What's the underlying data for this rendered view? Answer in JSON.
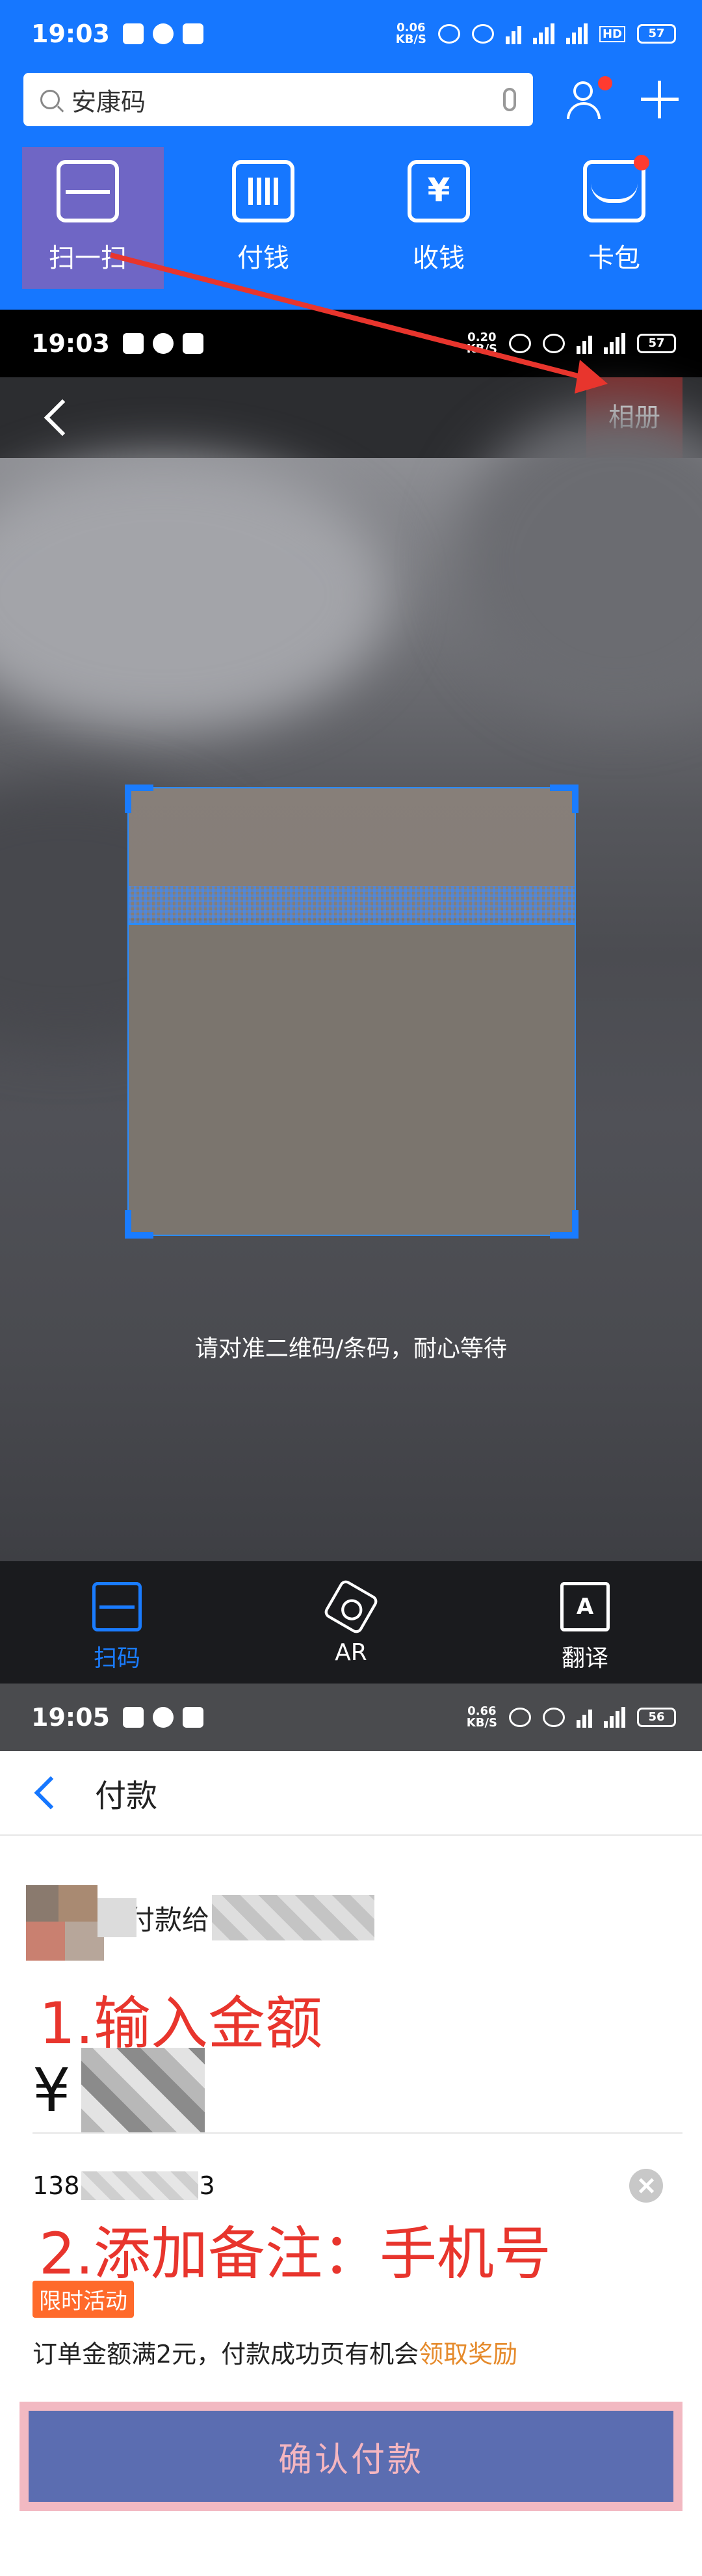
{
  "home": {
    "status": {
      "time": "19:03",
      "net_speed": "0.06",
      "net_unit": "KB/S",
      "signal1": "4G",
      "signal2": "4G",
      "hd": "HD",
      "battery": "57"
    },
    "search": {
      "placeholder": "安康码"
    },
    "quick_actions": [
      {
        "label": "扫一扫",
        "icon": "scan-icon"
      },
      {
        "label": "付钱",
        "icon": "barcode-icon"
      },
      {
        "label": "收钱",
        "icon": "yen-icon"
      },
      {
        "label": "卡包",
        "icon": "wallet-icon"
      }
    ]
  },
  "scanner": {
    "status": {
      "time": "19:03",
      "net_speed": "0.20",
      "net_unit": "KB/S",
      "battery": "57"
    },
    "album_label": "相册",
    "hint": "请对准二维码/条码，耐心等待",
    "tabs": [
      {
        "label": "扫码",
        "icon": "scan-icon",
        "active": true
      },
      {
        "label": "AR",
        "icon": "ar-icon",
        "active": false
      },
      {
        "label": "翻译",
        "icon": "translate-icon",
        "active": false
      }
    ]
  },
  "payment": {
    "status": {
      "time": "19:05",
      "net_speed": "0.66",
      "net_unit": "KB/S",
      "battery": "56"
    },
    "title": "付款",
    "payee_label": "付款给",
    "step1_annotation": "1.输入金额",
    "currency": "¥",
    "remark_prefix": "138",
    "remark_suffix": "3",
    "step2_annotation": "2.添加备注：手机号",
    "promo_badge": "限时活动",
    "promo_text": "订单金额满2元，付款成功页有机会",
    "promo_link": "领取奖励",
    "confirm_label": "确认付款"
  },
  "colors": {
    "brand_blue": "#1677ff",
    "annotation_red": "#e8352d",
    "scan_blue": "#1a7cff",
    "confirm_bg": "#5b6db1"
  }
}
